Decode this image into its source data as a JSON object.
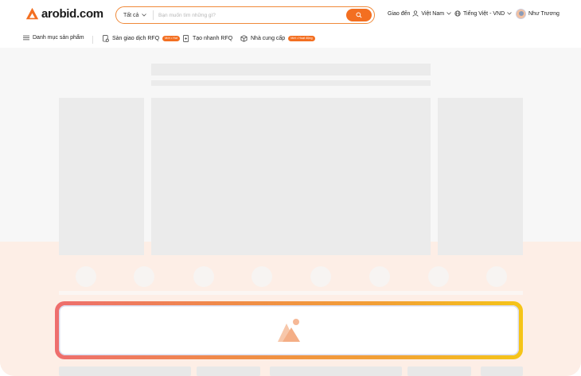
{
  "header": {
    "logo_text": "arobid.com",
    "search": {
      "category": "Tất cả",
      "placeholder": "Bạn muốn tìm những gì?"
    },
    "deliver_label": "Giao đến",
    "deliver_location": "Việt Nam",
    "language_currency": "Tiếng Việt - VND",
    "user_name": "Như Trương"
  },
  "subnav": {
    "categories_label": "Danh mục sản phẩm",
    "rfq_exchange_label": "Sàn giao dịch RFQ",
    "rfq_exchange_badge": "Mới • Hot",
    "quick_rfq_label": "Tạo nhanh RFQ",
    "suppliers_label": "Nhà cung cấp",
    "suppliers_badge": "Mới • Hoạt động"
  },
  "colors": {
    "accent": "#f36f21",
    "skeleton": "#ebebeb",
    "peach_band": "#fdeee6"
  },
  "icons": [
    "logo-mark-icon",
    "chevron-down-icon",
    "search-icon",
    "user-location-icon",
    "globe-icon",
    "avatar",
    "menu-list-icon",
    "rfq-doc-icon",
    "quick-rfq-icon",
    "box-icon",
    "image-placeholder-icon"
  ]
}
